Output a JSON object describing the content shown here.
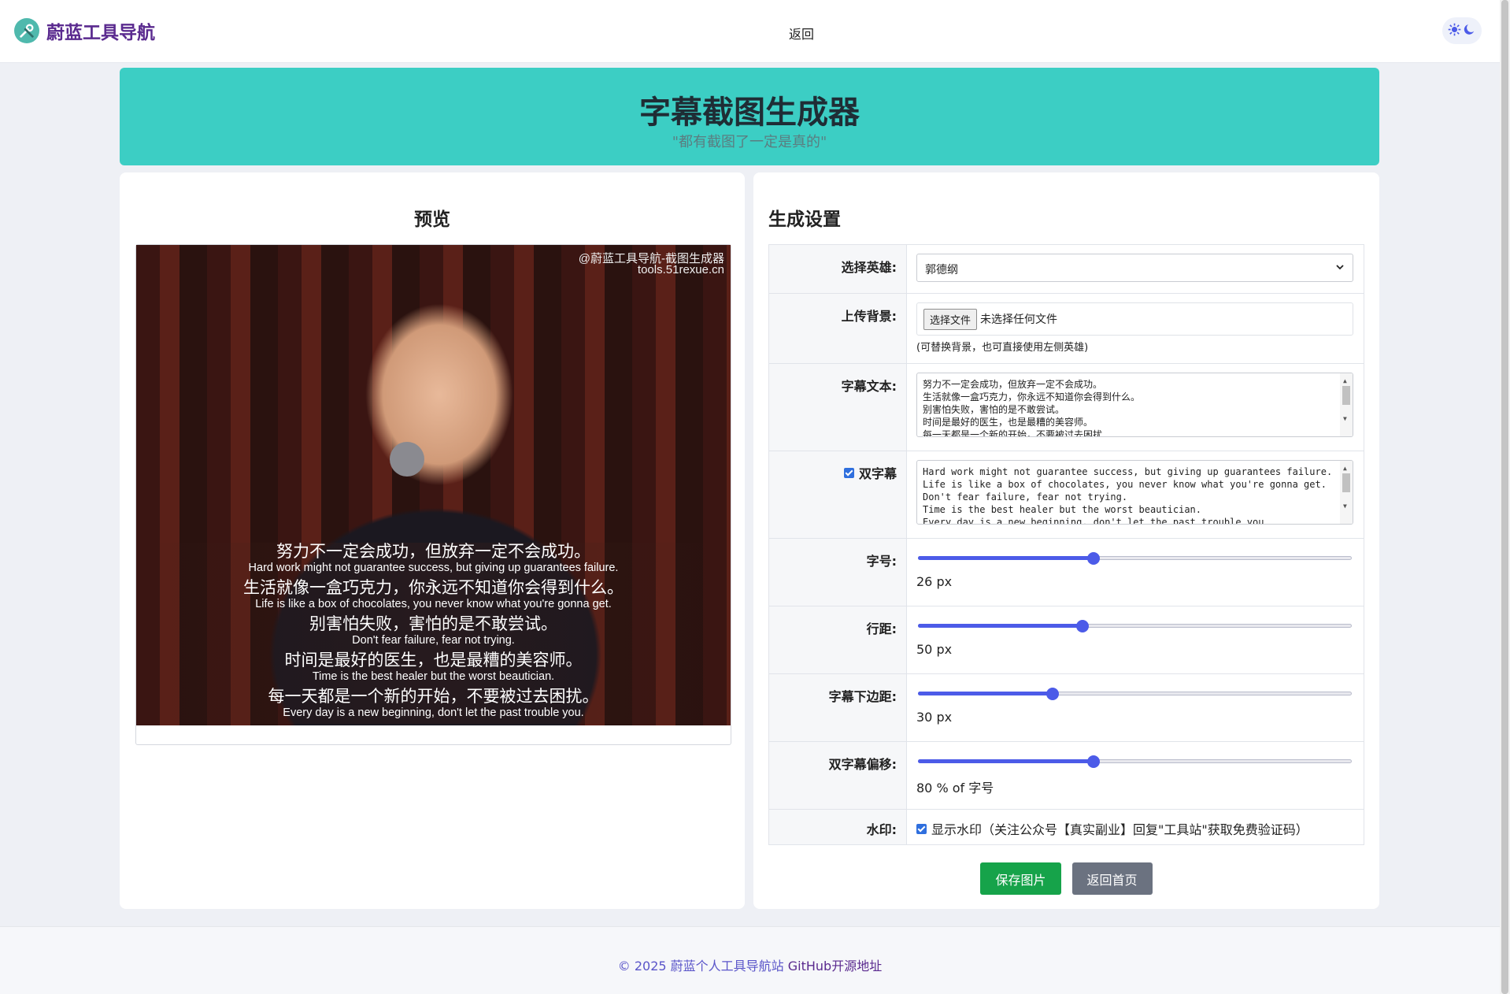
{
  "header": {
    "brand_title": "蔚蓝工具导航",
    "back_label": "返回",
    "logo_icon": "wrench-screwdriver-icon",
    "theme_icons": [
      "sun-icon",
      "moon-icon"
    ]
  },
  "banner": {
    "title": "字幕截图生成器",
    "subtitle": "\"都有截图了一定是真的\"",
    "color": "#3ccec4"
  },
  "preview": {
    "title": "预览",
    "watermark_line1": "@蔚蓝工具导航-截图生成器",
    "watermark_line2": "tools.51rexue.cn",
    "subtitles": [
      {
        "cn": "努力不一定会成功，但放弃一定不会成功。",
        "en": "Hard work might not guarantee success, but giving up guarantees failure."
      },
      {
        "cn": "生活就像一盒巧克力，你永远不知道你会得到什么。",
        "en": "Life is like a box of chocolates, you never know what you're gonna get."
      },
      {
        "cn": "别害怕失败，害怕的是不敢尝试。",
        "en": "Don't fear failure, fear not trying."
      },
      {
        "cn": "时间是最好的医生，也是最糟的美容师。",
        "en": "Time is the best healer but the worst beautician."
      },
      {
        "cn": "每一天都是一个新的开始，不要被过去困扰。",
        "en": "Every day is a new beginning, don't let the past trouble you."
      }
    ]
  },
  "settings": {
    "title": "生成设置",
    "hero": {
      "label": "选择英雄:",
      "value": "郭德纲"
    },
    "background": {
      "label": "上传背景:",
      "button": "选择文件",
      "status": "未选择任何文件",
      "hint": "(可替换背景，也可直接使用左侧英雄)"
    },
    "subtitle_text": {
      "label": "字幕文本:",
      "lines": [
        "努力不一定会成功，但放弃一定不会成功。",
        "生活就像一盒巧克力，你永远不知道你会得到什么。",
        "别害怕失败，害怕的是不敢尝试。",
        "时间是最好的医生，也是最糟的美容师。",
        "每一天都是一个新的开始，不要被过去困扰"
      ]
    },
    "dual": {
      "label": "双字幕",
      "checked": true,
      "lines": [
        "Hard work might not guarantee success, but giving up guarantees failure.",
        "Life is like a box of chocolates, you never know what you're gonna get.",
        "Don't fear failure, fear not trying.",
        "Time is the best healer but the worst beautician.",
        "Every day is a new beginning, don't let the past trouble you."
      ]
    },
    "font_size": {
      "label": "字号:",
      "display": "26 px",
      "fraction": 0.405
    },
    "line_height": {
      "label": "行距:",
      "display": "50 px",
      "fraction": 0.38
    },
    "bottom_margin": {
      "label": "字幕下边距:",
      "display": "30 px",
      "fraction": 0.31
    },
    "dual_offset": {
      "label": "双字幕偏移:",
      "display": "80 % of 字号",
      "fraction": 0.405
    },
    "watermark": {
      "label": "水印:",
      "text": "显示水印（关注公众号【真实副业】回复\"工具站\"获取免费验证码）",
      "checked": true
    },
    "save_label": "保存图片",
    "home_label": "返回首页"
  },
  "footer": {
    "copyright": "© 2025 蔚蓝个人工具导航站",
    "github": "GitHub开源地址"
  },
  "colors": {
    "accent": "#4c5be8",
    "save": "#16a34a",
    "home": "#6b7280",
    "brand": "#5a2a8f"
  }
}
